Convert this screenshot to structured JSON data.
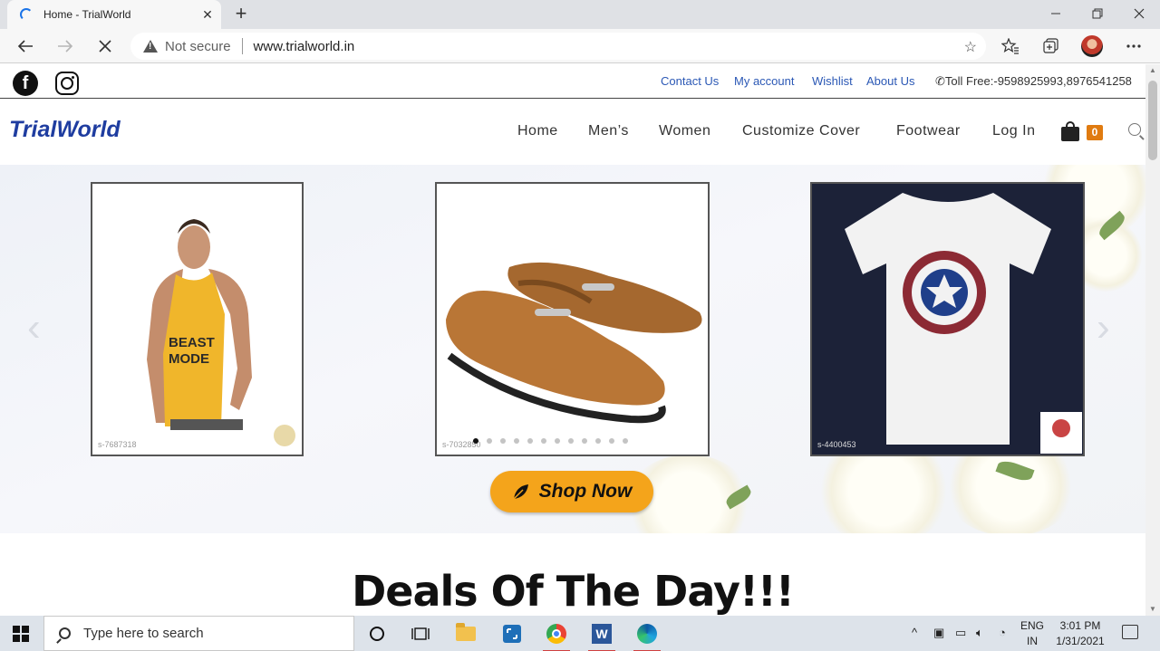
{
  "browser": {
    "tab_title": "Home - TrialWorld",
    "tab_close": "✕",
    "new_tab": "+",
    "security_label": "Not secure",
    "url": "www.trialworld.in"
  },
  "social": {
    "facebook_glyph": "f"
  },
  "top_links": {
    "contact": "Contact Us",
    "account": "My account",
    "wishlist": "Wishlist",
    "about": "About Us",
    "toll_free": "Toll Free:-9598925993,8976541258"
  },
  "header": {
    "logo": "TrialWorld",
    "menu": [
      "Home",
      "Men’s",
      "Women",
      "Customize Cover",
      "Footwear",
      "Log In"
    ],
    "cart_count": "0"
  },
  "hero": {
    "cards": [
      {
        "code": "s-7687318",
        "print_line1": "BEAST",
        "print_line2": "MODE"
      },
      {
        "code": "s-7032850"
      },
      {
        "code": "s-4400453"
      }
    ],
    "slide_count": 12,
    "active_slide": 1,
    "shop_button": "Shop Now"
  },
  "section": {
    "deals_title": "Deals Of The Day!!!"
  },
  "taskbar": {
    "search_placeholder": "Type here to search",
    "lang_line1": "ENG",
    "lang_line2": "IN",
    "time": "3:01 PM",
    "date": "1/31/2021"
  },
  "colors": {
    "accent_orange": "#f4a41b",
    "logo_blue": "#1f3da0",
    "link_blue": "#2b58b5",
    "cart_badge": "#e07b10"
  }
}
